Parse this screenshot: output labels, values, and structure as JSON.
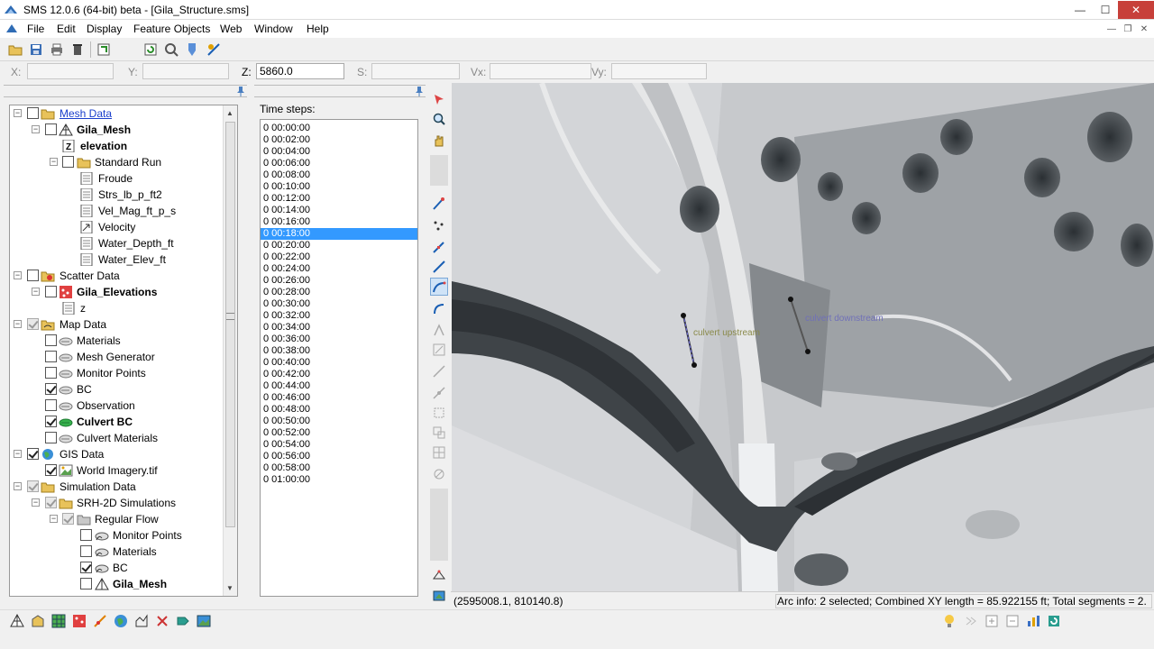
{
  "window": {
    "title": "SMS 12.0.6 (64-bit) beta - [Gila_Structure.sms]"
  },
  "window_controls": {
    "minimize": "—",
    "maximize": "☐",
    "close": "✕"
  },
  "mdi_controls": {
    "minimize": "—",
    "restore": "❐",
    "close": "✕"
  },
  "menu": {
    "items": [
      "File",
      "Edit",
      "Display",
      "Feature Objects",
      "Web",
      "Window",
      "Help"
    ]
  },
  "edit_bar": {
    "x_label": "X:",
    "x_value": "",
    "y_label": "Y:",
    "y_value": "",
    "z_label": "Z:",
    "z_value": "5860.0",
    "s_label": "S:",
    "s_value": "",
    "vx_label": "Vx:",
    "vx_value": "",
    "vy_label": "Vy:",
    "vy_value": ""
  },
  "tree": {
    "mesh_data": "Mesh Data",
    "gila_mesh": "Gila_Mesh",
    "elevation": "elevation",
    "standard_run": "Standard Run",
    "froude": "Froude",
    "strs": "Strs_lb_p_ft2",
    "vel_mag": "Vel_Mag_ft_p_s",
    "velocity": "Velocity",
    "water_depth": "Water_Depth_ft",
    "water_elev": "Water_Elev_ft",
    "scatter_data": "Scatter Data",
    "gila_elevations": "Gila_Elevations",
    "z": "z",
    "map_data": "Map Data",
    "materials": "Materials",
    "mesh_generator": "Mesh Generator",
    "monitor_points": "Monitor Points",
    "bc": "BC",
    "observation": "Observation",
    "culvert_bc": "Culvert BC",
    "culvert_materials": "Culvert Materials",
    "gis_data": "GIS Data",
    "world_imagery": "World Imagery.tif",
    "simulation_data": "Simulation Data",
    "srh2d": "SRH-2D Simulations",
    "regular_flow": "Regular Flow",
    "sim_monitor_points": "Monitor Points",
    "sim_materials": "Materials",
    "sim_bc": "BC",
    "sim_gila_mesh": "Gila_Mesh"
  },
  "time_steps": {
    "label": "Time steps:",
    "selected": "0 00:18:00",
    "items": [
      "0 00:00:00",
      "0 00:02:00",
      "0 00:04:00",
      "0 00:06:00",
      "0 00:08:00",
      "0 00:10:00",
      "0 00:12:00",
      "0 00:14:00",
      "0 00:16:00",
      "0 00:18:00",
      "0 00:20:00",
      "0 00:22:00",
      "0 00:24:00",
      "0 00:26:00",
      "0 00:28:00",
      "0 00:30:00",
      "0 00:32:00",
      "0 00:34:00",
      "0 00:36:00",
      "0 00:38:00",
      "0 00:40:00",
      "0 00:42:00",
      "0 00:44:00",
      "0 00:46:00",
      "0 00:48:00",
      "0 00:50:00",
      "0 00:52:00",
      "0 00:54:00",
      "0 00:56:00",
      "0 00:58:00",
      "0 01:00:00"
    ]
  },
  "map": {
    "label_upstream": "culvert upstream",
    "label_downstream": "culvert downstream"
  },
  "status": {
    "coordinates": "(2595008.1, 810140.8)",
    "arc_info": "Arc info: 2 selected; Combined XY length = 85.922155 ft; Total segments = 2."
  },
  "colors": {
    "selection": "#3399ff",
    "link": "#1a3fcc",
    "close_button": "#c7403a"
  }
}
